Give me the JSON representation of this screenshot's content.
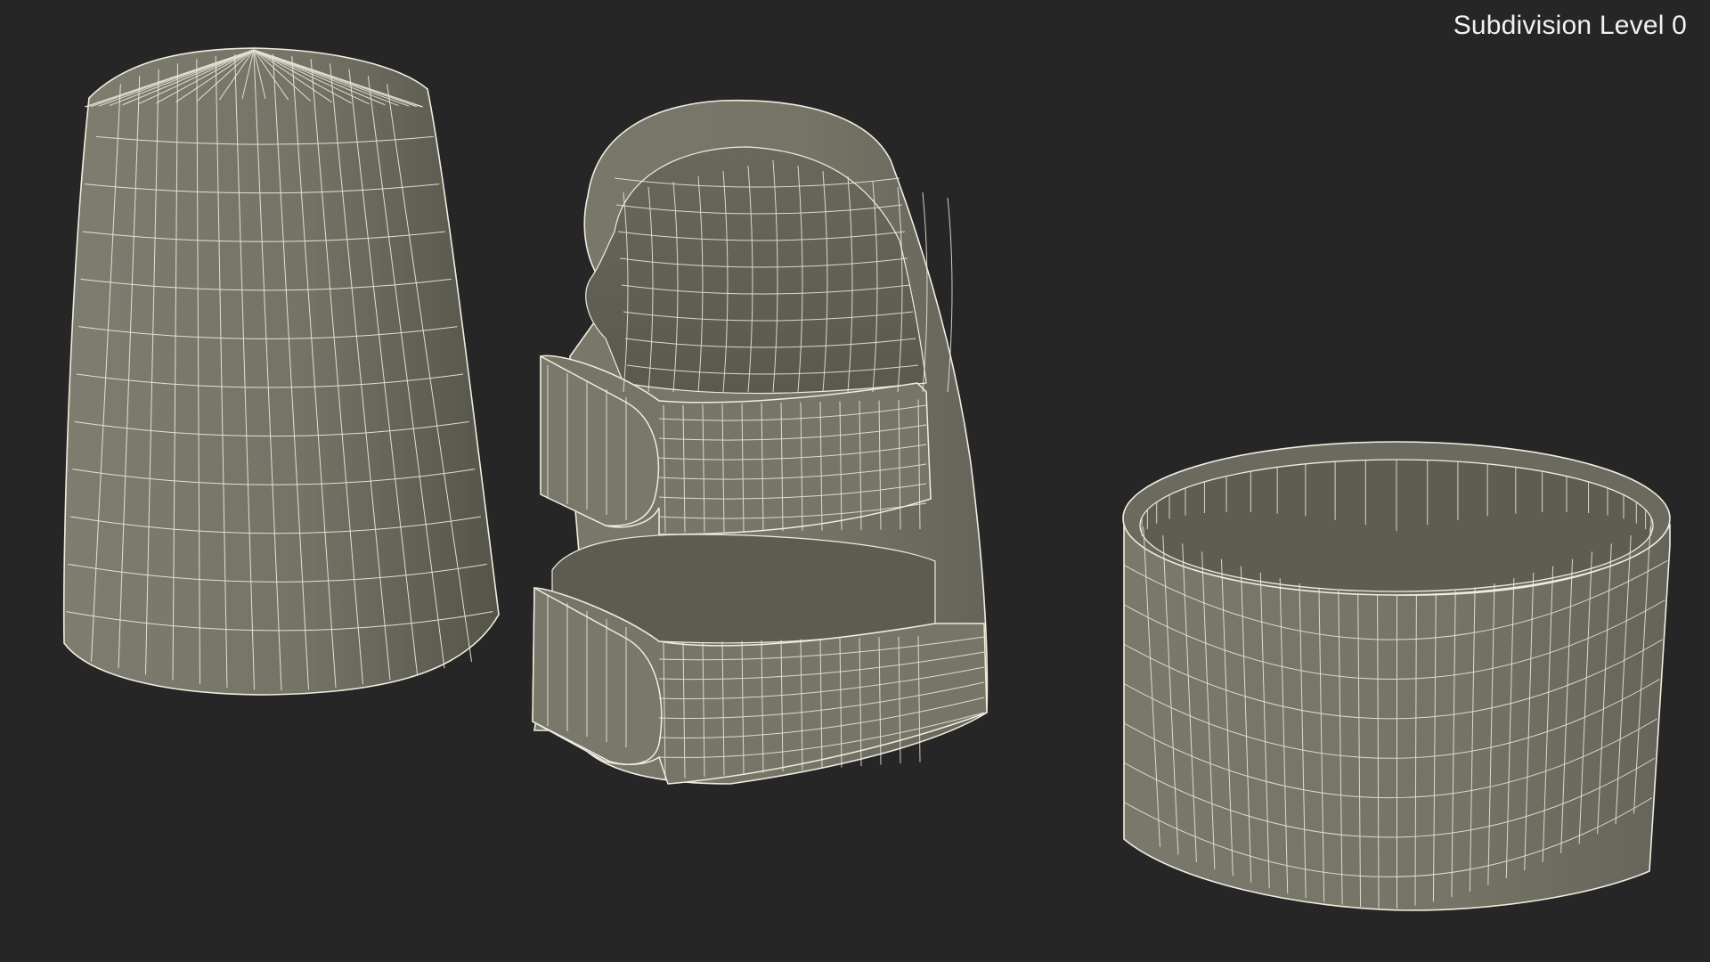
{
  "viewport": {
    "subdivision_label": "Subdivision Level 0",
    "background_color": "#262626"
  },
  "objects": [
    {
      "name": "thimble-cap"
    },
    {
      "name": "finger-splint-with-straps"
    },
    {
      "name": "ring-band"
    }
  ],
  "colors": {
    "surface": "#767466",
    "surface_dark": "#5d5b50",
    "wire": "#efede0"
  }
}
